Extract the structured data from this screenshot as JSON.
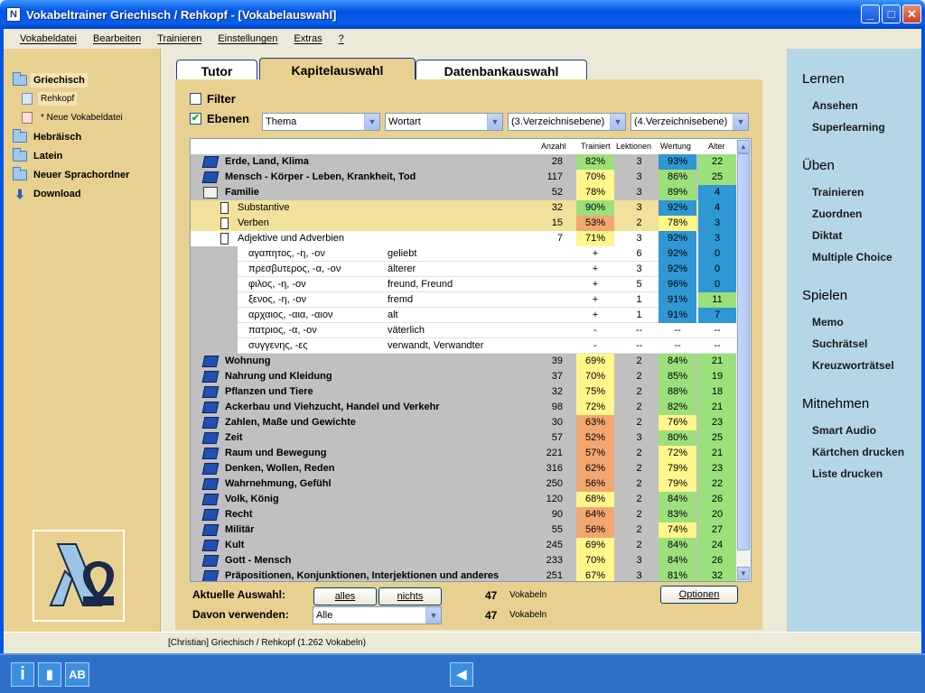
{
  "window": {
    "title": "Vokabeltrainer Griechisch / Rehkopf - [Vokabelauswahl]",
    "app_icon": "N",
    "buttons": {
      "min": "_",
      "max": "□",
      "close": "✕"
    }
  },
  "menu": [
    "Vokabeldatei",
    "Bearbeiten",
    "Trainieren",
    "Einstellungen",
    "Extras",
    "?"
  ],
  "tree": [
    {
      "label": "Griechisch",
      "icon": "folder-open-icon",
      "selected": true
    },
    {
      "label": "Rehkopf",
      "icon": "book-icon",
      "sub": true,
      "selected": true
    },
    {
      "label": "* Neue Vokabeldatei",
      "icon": "new-book-icon",
      "sub": true
    },
    {
      "label": "Hebräisch",
      "icon": "folder-icon"
    },
    {
      "label": "Latein",
      "icon": "folder-icon"
    },
    {
      "label": "Neuer Sprachordner",
      "icon": "folder-icon"
    },
    {
      "label": "Download",
      "icon": "download-arrow-icon"
    }
  ],
  "tabs": [
    "Tutor",
    "Kapitelauswahl",
    "Datenbankauswahl"
  ],
  "filter_label": "Filter",
  "ebenen_label": "Ebenen",
  "combos": [
    "Thema",
    "Wortart",
    "(3.Verzeichnisebene)",
    "(4.Verzeichnisebene)"
  ],
  "grid_headers": {
    "anzahl": "Anzahl",
    "trainiert": "Trainiert",
    "lektionen": "Lektionen",
    "wertung": "Wertung",
    "alter": "Alter"
  },
  "colors": {
    "green": "#9CE07C",
    "yellow": "#FFF68C",
    "orange": "#F2A670",
    "blue": "#2F97D3",
    "lightblue": "#2F97D3",
    "lightgreen": "#9CE07C"
  },
  "rows": [
    {
      "type": "gray",
      "level": 0,
      "icon": "book",
      "name": "Erde, Land, Klima",
      "anzahl": "28",
      "trainiert": "82%",
      "tc": "green",
      "lektionen": "3",
      "wertung": "93%",
      "wc": "blue",
      "alter": "22",
      "ac": "green"
    },
    {
      "type": "gray",
      "level": 0,
      "icon": "book",
      "name": "Mensch - Körper - Leben, Krankheit, Tod",
      "anzahl": "117",
      "trainiert": "70%",
      "tc": "yellow",
      "lektionen": "3",
      "wertung": "86%",
      "wc": "green",
      "alter": "25",
      "ac": "green"
    },
    {
      "type": "gray",
      "level": 0,
      "icon": "openbook",
      "name": "Familie",
      "anzahl": "52",
      "trainiert": "78%",
      "tc": "yellow",
      "lektionen": "3",
      "wertung": "89%",
      "wc": "green",
      "alter": "4",
      "ac": "blue"
    },
    {
      "type": "yellow",
      "level": 1,
      "icon": "doc",
      "name": "Substantive",
      "anzahl": "32",
      "trainiert": "90%",
      "tc": "green",
      "lektionen": "3",
      "wertung": "92%",
      "wc": "blue",
      "alter": "4",
      "ac": "blue"
    },
    {
      "type": "yellow",
      "level": 1,
      "icon": "doc",
      "name": "Verben",
      "anzahl": "15",
      "trainiert": "53%",
      "tc": "orange",
      "lektionen": "2",
      "wertung": "78%",
      "wc": "yellow",
      "alter": "3",
      "ac": "blue"
    },
    {
      "type": "white",
      "level": 1,
      "icon": "doc-empty",
      "name": "Adjektive und Adverbien",
      "anzahl": "7",
      "trainiert": "71%",
      "tc": "yellow",
      "lektionen": "3",
      "wertung": "92%",
      "wc": "blue",
      "alter": "3",
      "ac": "blue"
    },
    {
      "type": "word",
      "gr": "αγαπητος, -η, -ον",
      "de": "geliebt",
      "trainiert": "+",
      "lektionen": "6",
      "wertung": "92%",
      "wc": "blue",
      "alter": "0",
      "ac": "blue"
    },
    {
      "type": "word",
      "gr": "πρεσβυτερος, -α, -ον",
      "de": "älterer",
      "trainiert": "+",
      "lektionen": "3",
      "wertung": "92%",
      "wc": "blue",
      "alter": "0",
      "ac": "blue"
    },
    {
      "type": "word",
      "gr": "φιλος, -η, -ον",
      "de": "freund, Freund",
      "trainiert": "+",
      "lektionen": "5",
      "wertung": "96%",
      "wc": "blue",
      "alter": "0",
      "ac": "blue"
    },
    {
      "type": "word",
      "gr": "ξενος, -η, -ον",
      "de": "fremd",
      "trainiert": "+",
      "lektionen": "1",
      "wertung": "91%",
      "wc": "blue",
      "alter": "11",
      "ac": "green"
    },
    {
      "type": "word",
      "gr": "αρχαιος, -αια, -αιον",
      "de": "alt",
      "trainiert": "+",
      "lektionen": "1",
      "wertung": "91%",
      "wc": "blue",
      "alter": "7",
      "ac": "blue"
    },
    {
      "type": "word",
      "gr": "πατριος, -α, -ον",
      "de": "väterlich",
      "trainiert": "-",
      "lektionen": "--",
      "wertung": "--",
      "wc": "",
      "alter": "--",
      "ac": ""
    },
    {
      "type": "word",
      "gr": "συγγενης, -ες",
      "de": "verwandt, Verwandter",
      "trainiert": "-",
      "lektionen": "--",
      "wertung": "--",
      "wc": "",
      "alter": "--",
      "ac": ""
    },
    {
      "type": "gray",
      "level": 0,
      "icon": "book",
      "name": "Wohnung",
      "anzahl": "39",
      "trainiert": "69%",
      "tc": "yellow",
      "lektionen": "2",
      "wertung": "84%",
      "wc": "green",
      "alter": "21",
      "ac": "green"
    },
    {
      "type": "gray",
      "level": 0,
      "icon": "book",
      "name": "Nahrung und Kleidung",
      "anzahl": "37",
      "trainiert": "70%",
      "tc": "yellow",
      "lektionen": "2",
      "wertung": "85%",
      "wc": "green",
      "alter": "19",
      "ac": "green"
    },
    {
      "type": "gray",
      "level": 0,
      "icon": "book",
      "name": "Pflanzen und Tiere",
      "anzahl": "32",
      "trainiert": "75%",
      "tc": "yellow",
      "lektionen": "2",
      "wertung": "88%",
      "wc": "green",
      "alter": "18",
      "ac": "green"
    },
    {
      "type": "gray",
      "level": 0,
      "icon": "book",
      "name": "Ackerbau und Viehzucht, Handel und Verkehr",
      "anzahl": "98",
      "trainiert": "72%",
      "tc": "yellow",
      "lektionen": "2",
      "wertung": "82%",
      "wc": "green",
      "alter": "21",
      "ac": "green"
    },
    {
      "type": "gray",
      "level": 0,
      "icon": "book",
      "name": "Zahlen, Maße und Gewichte",
      "anzahl": "30",
      "trainiert": "63%",
      "tc": "orange",
      "lektionen": "2",
      "wertung": "76%",
      "wc": "yellow",
      "alter": "23",
      "ac": "green"
    },
    {
      "type": "gray",
      "level": 0,
      "icon": "book",
      "name": "Zeit",
      "anzahl": "57",
      "trainiert": "52%",
      "tc": "orange",
      "lektionen": "3",
      "wertung": "80%",
      "wc": "green",
      "alter": "25",
      "ac": "green"
    },
    {
      "type": "gray",
      "level": 0,
      "icon": "book",
      "name": "Raum und Bewegung",
      "anzahl": "221",
      "trainiert": "57%",
      "tc": "orange",
      "lektionen": "2",
      "wertung": "72%",
      "wc": "yellow",
      "alter": "21",
      "ac": "green"
    },
    {
      "type": "gray",
      "level": 0,
      "icon": "book",
      "name": "Denken, Wollen, Reden",
      "anzahl": "316",
      "trainiert": "62%",
      "tc": "orange",
      "lektionen": "2",
      "wertung": "79%",
      "wc": "yellow",
      "alter": "23",
      "ac": "green"
    },
    {
      "type": "gray",
      "level": 0,
      "icon": "book",
      "name": "Wahrnehmung, Gefühl",
      "anzahl": "250",
      "trainiert": "56%",
      "tc": "orange",
      "lektionen": "2",
      "wertung": "79%",
      "wc": "yellow",
      "alter": "22",
      "ac": "green"
    },
    {
      "type": "gray",
      "level": 0,
      "icon": "book",
      "name": "Volk, König",
      "anzahl": "120",
      "trainiert": "68%",
      "tc": "yellow",
      "lektionen": "2",
      "wertung": "84%",
      "wc": "green",
      "alter": "26",
      "ac": "green"
    },
    {
      "type": "gray",
      "level": 0,
      "icon": "book",
      "name": "Recht",
      "anzahl": "90",
      "trainiert": "64%",
      "tc": "orange",
      "lektionen": "2",
      "wertung": "83%",
      "wc": "green",
      "alter": "20",
      "ac": "green"
    },
    {
      "type": "gray",
      "level": 0,
      "icon": "book",
      "name": "Militär",
      "anzahl": "55",
      "trainiert": "56%",
      "tc": "orange",
      "lektionen": "2",
      "wertung": "74%",
      "wc": "yellow",
      "alter": "27",
      "ac": "green"
    },
    {
      "type": "gray",
      "level": 0,
      "icon": "book",
      "name": "Kult",
      "anzahl": "245",
      "trainiert": "69%",
      "tc": "yellow",
      "lektionen": "2",
      "wertung": "84%",
      "wc": "green",
      "alter": "24",
      "ac": "green"
    },
    {
      "type": "gray",
      "level": 0,
      "icon": "book",
      "name": "Gott - Mensch",
      "anzahl": "233",
      "trainiert": "70%",
      "tc": "yellow",
      "lektionen": "3",
      "wertung": "84%",
      "wc": "green",
      "alter": "26",
      "ac": "green"
    },
    {
      "type": "gray",
      "level": 0,
      "icon": "book",
      "name": "Präpositionen, Konjunktionen, Interjektionen und anderes",
      "anzahl": "251",
      "trainiert": "67%",
      "tc": "yellow",
      "lektionen": "3",
      "wertung": "81%",
      "wc": "green",
      "alter": "32",
      "ac": "green"
    }
  ],
  "bottom": {
    "aktuelle_label": "Aktuelle Auswahl:",
    "alles": "alles",
    "nichts": "nichts",
    "count1": "47",
    "vokabeln1": "Vokabeln",
    "optionen": "Optionen",
    "davon_label": "Davon verwenden:",
    "davon_value": "Alle",
    "count2": "47",
    "vokabeln2": "Vokabeln"
  },
  "right_sidebar": [
    {
      "title": "Lernen",
      "items": [
        "Ansehen",
        "Superlearning"
      ]
    },
    {
      "title": "Üben",
      "items": [
        "Trainieren",
        "Zuordnen",
        "Diktat",
        "Multiple Choice"
      ]
    },
    {
      "title": "Spielen",
      "items": [
        "Memo",
        "Suchrätsel",
        "Kreuzworträtsel"
      ]
    },
    {
      "title": "Mitnehmen",
      "items": [
        "Smart Audio",
        "Kärtchen drucken",
        "Liste drucken"
      ]
    }
  ],
  "status_text": "[Christian]  Griechisch / Rehkopf  (1.262 Vokabeln)",
  "taskbar": {
    "info": "i",
    "book": "▮",
    "ab": "AB",
    "back": "◀"
  }
}
